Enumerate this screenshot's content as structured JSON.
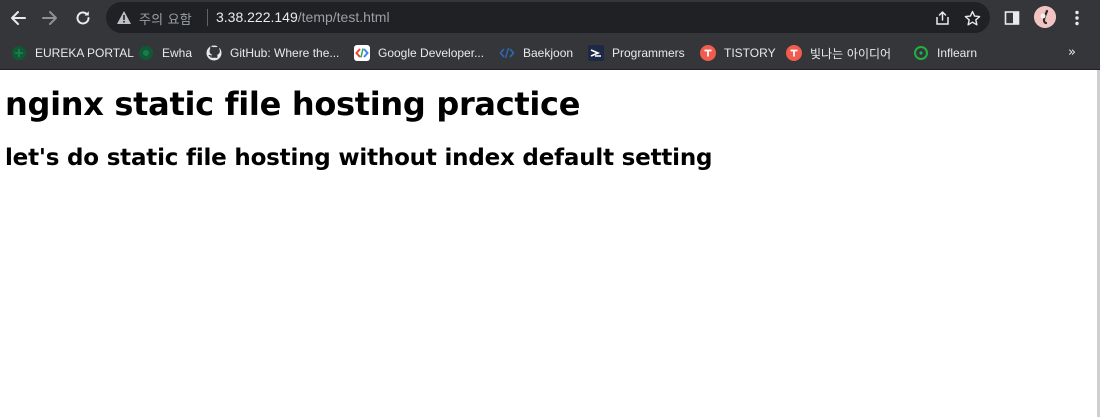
{
  "toolbar": {
    "security_warning": "주의 요함",
    "url_host": "3.38.222.149",
    "url_path": "/temp/test.html"
  },
  "icons": {
    "back": "arrow-left-icon",
    "forward": "arrow-right-icon",
    "reload": "reload-icon",
    "warning": "warning-icon",
    "share": "share-icon",
    "bookmark_star": "star-icon",
    "side_panel": "side-panel-icon",
    "menu": "kebab-menu-icon",
    "bookmarks_overflow": "chevron-double-right-icon"
  },
  "bookmarks": [
    {
      "label": "EUREKA PORTAL",
      "icon": "eureka-icon"
    },
    {
      "label": "Ewha",
      "icon": "ewha-icon"
    },
    {
      "label": "GitHub: Where the...",
      "icon": "github-icon"
    },
    {
      "label": "Google Developer...",
      "icon": "google-developers-icon"
    },
    {
      "label": "Baekjoon",
      "icon": "baekjoon-icon"
    },
    {
      "label": "Programmers",
      "icon": "programmers-icon"
    },
    {
      "label": "TISTORY",
      "icon": "tistory-icon"
    },
    {
      "label": "빛나는 아이디어",
      "icon": "tistory-icon"
    },
    {
      "label": "Inflearn",
      "icon": "inflearn-icon"
    }
  ],
  "bookmarks_overflow_label": "»",
  "page": {
    "h1": "nginx static file hosting practice",
    "h2": "let's do static file hosting without index default setting"
  },
  "colors": {
    "toolbar_bg": "#35363a",
    "omnibox_bg": "#202124",
    "page_bg": "#ffffff",
    "text_light": "#e8eaed",
    "text_muted": "#9aa0a6"
  }
}
